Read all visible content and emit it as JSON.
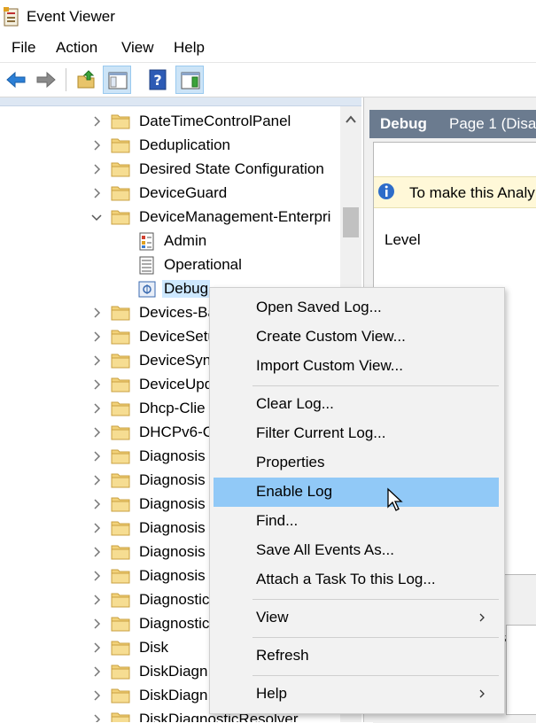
{
  "window": {
    "title": "Event Viewer"
  },
  "menu": [
    "File",
    "Action",
    "View",
    "Help"
  ],
  "toolbar": {
    "buttons": [
      "back-arrow-icon",
      "forward-arrow-icon",
      "open-folder-icon",
      "show-hide-tree-icon",
      "help-icon",
      "show-hide-action-pane-icon"
    ]
  },
  "tree": {
    "items": [
      {
        "label": "DateTimeControlPanel",
        "type": "folder"
      },
      {
        "label": "Deduplication",
        "type": "folder"
      },
      {
        "label": "Desired State Configuration",
        "type": "folder"
      },
      {
        "label": "DeviceGuard",
        "type": "folder"
      },
      {
        "label": "DeviceManagement-Enterpri",
        "type": "folder",
        "expanded": true
      },
      {
        "label": "Admin",
        "type": "log"
      },
      {
        "label": "Operational",
        "type": "log"
      },
      {
        "label": "Debug",
        "type": "log",
        "selected": true
      },
      {
        "label": "Devices-Ba",
        "type": "folder"
      },
      {
        "label": "DeviceSetu",
        "type": "folder"
      },
      {
        "label": "DeviceSync",
        "type": "folder"
      },
      {
        "label": "DeviceUpd",
        "type": "folder"
      },
      {
        "label": "Dhcp-Clie",
        "type": "folder"
      },
      {
        "label": "DHCPv6-C",
        "type": "folder"
      },
      {
        "label": "Diagnosis",
        "type": "folder"
      },
      {
        "label": "Diagnosis",
        "type": "folder"
      },
      {
        "label": "Diagnosis",
        "type": "folder"
      },
      {
        "label": "Diagnosis",
        "type": "folder"
      },
      {
        "label": "Diagnosis",
        "type": "folder"
      },
      {
        "label": "Diagnosis",
        "type": "folder"
      },
      {
        "label": "Diagnostic",
        "type": "folder"
      },
      {
        "label": "Diagnostic",
        "type": "folder"
      },
      {
        "label": "Disk",
        "type": "folder"
      },
      {
        "label": "DiskDiagn",
        "type": "folder"
      },
      {
        "label": "DiskDiagn",
        "type": "folder"
      },
      {
        "label": "DiskDiagnosticResolver",
        "type": "folder"
      }
    ]
  },
  "right_pane": {
    "header_name": "Debug",
    "header_page": "Page 1  (Disa",
    "info_text": "To make this Analy",
    "column_level": "Level",
    "lower_fragment": "s"
  },
  "context_menu": {
    "items": [
      {
        "label": "Open Saved Log...",
        "group": 0
      },
      {
        "label": "Create Custom View...",
        "group": 0
      },
      {
        "label": "Import Custom View...",
        "group": 0
      },
      {
        "label": "Clear Log...",
        "group": 1
      },
      {
        "label": "Filter Current Log...",
        "group": 1
      },
      {
        "label": "Properties",
        "group": 1
      },
      {
        "label": "Enable Log",
        "group": 1,
        "highlighted": true
      },
      {
        "label": "Find...",
        "group": 1
      },
      {
        "label": "Save All Events As...",
        "group": 1
      },
      {
        "label": "Attach a Task To this Log...",
        "group": 1
      },
      {
        "label": "View",
        "group": 2,
        "submenu": true
      },
      {
        "label": "Refresh",
        "group": 3
      },
      {
        "label": "Help",
        "group": 4,
        "submenu": true
      }
    ]
  },
  "colors": {
    "hover": "#91c9f7",
    "selected": "#cde8ff",
    "header": "#6b7b8f",
    "folder": "#e8c46a"
  }
}
